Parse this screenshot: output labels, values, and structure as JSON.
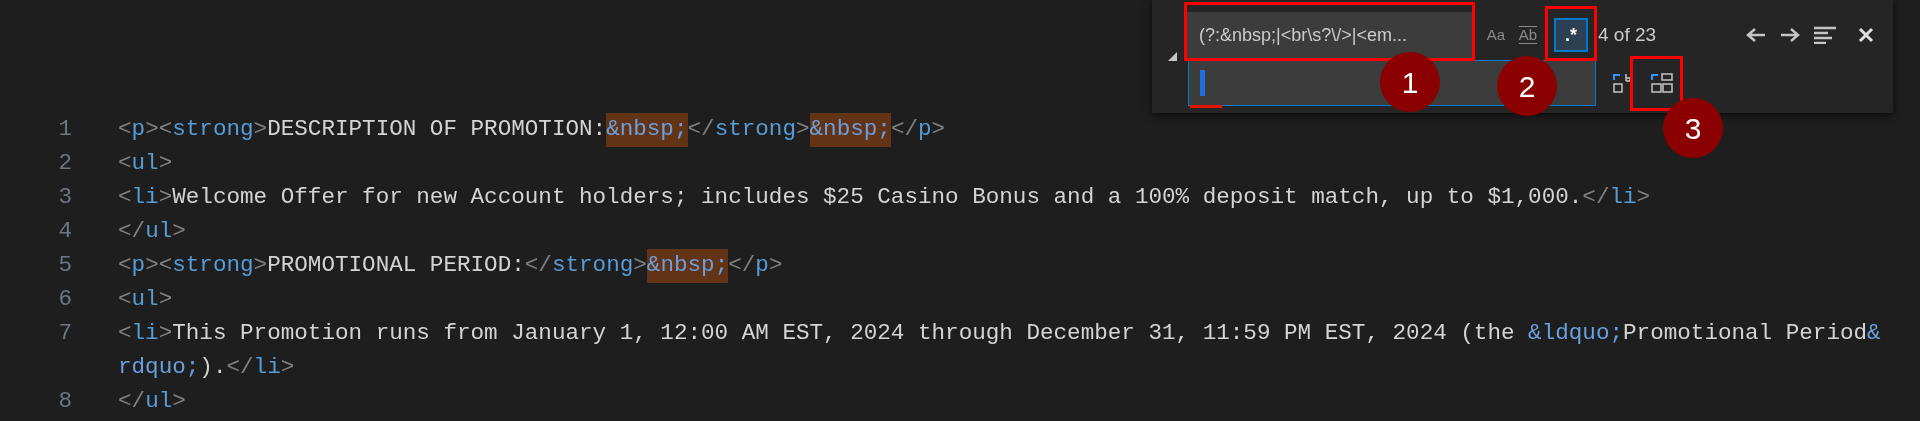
{
  "editor": {
    "lines": [
      {
        "number": "1",
        "tokens": [
          {
            "kind": "bracket",
            "text": "<"
          },
          {
            "kind": "tag",
            "text": "p"
          },
          {
            "kind": "bracket",
            "text": "><"
          },
          {
            "kind": "tag",
            "text": "strong"
          },
          {
            "kind": "bracket",
            "text": ">"
          },
          {
            "kind": "text",
            "text": "DESCRIPTION OF PROMOTION:"
          },
          {
            "kind": "entity",
            "text": "&nbsp;",
            "match": true
          },
          {
            "kind": "bracket",
            "text": "</"
          },
          {
            "kind": "tag",
            "text": "strong"
          },
          {
            "kind": "bracket",
            "text": ">"
          },
          {
            "kind": "entity",
            "text": "&nbsp;",
            "match": true
          },
          {
            "kind": "bracket",
            "text": "</"
          },
          {
            "kind": "tag",
            "text": "p"
          },
          {
            "kind": "bracket",
            "text": ">"
          }
        ]
      },
      {
        "number": "2",
        "tokens": [
          {
            "kind": "bracket",
            "text": "<"
          },
          {
            "kind": "tag",
            "text": "ul"
          },
          {
            "kind": "bracket",
            "text": ">"
          }
        ]
      },
      {
        "number": "3",
        "tokens": [
          {
            "kind": "bracket",
            "text": "<"
          },
          {
            "kind": "tag",
            "text": "li"
          },
          {
            "kind": "bracket",
            "text": ">"
          },
          {
            "kind": "text",
            "text": "Welcome Offer for new Account holders; includes $25 Casino Bonus and a 100% deposit match, up to $1,000."
          },
          {
            "kind": "bracket",
            "text": "</"
          },
          {
            "kind": "tag",
            "text": "li"
          },
          {
            "kind": "bracket",
            "text": ">"
          }
        ]
      },
      {
        "number": "4",
        "tokens": [
          {
            "kind": "bracket",
            "text": "</"
          },
          {
            "kind": "tag",
            "text": "ul"
          },
          {
            "kind": "bracket",
            "text": ">"
          }
        ]
      },
      {
        "number": "5",
        "tokens": [
          {
            "kind": "bracket",
            "text": "<"
          },
          {
            "kind": "tag",
            "text": "p"
          },
          {
            "kind": "bracket",
            "text": "><"
          },
          {
            "kind": "tag",
            "text": "strong"
          },
          {
            "kind": "bracket",
            "text": ">"
          },
          {
            "kind": "text",
            "text": "PROMOTIONAL PERIOD:"
          },
          {
            "kind": "bracket",
            "text": "</"
          },
          {
            "kind": "tag",
            "text": "strong"
          },
          {
            "kind": "bracket",
            "text": ">"
          },
          {
            "kind": "entity",
            "text": "&nbsp;",
            "match": true
          },
          {
            "kind": "bracket",
            "text": "</"
          },
          {
            "kind": "tag",
            "text": "p"
          },
          {
            "kind": "bracket",
            "text": ">"
          }
        ]
      },
      {
        "number": "6",
        "tokens": [
          {
            "kind": "bracket",
            "text": "<"
          },
          {
            "kind": "tag",
            "text": "ul"
          },
          {
            "kind": "bracket",
            "text": ">"
          }
        ]
      },
      {
        "number": "7",
        "tokens": [
          {
            "kind": "bracket",
            "text": "<"
          },
          {
            "kind": "tag",
            "text": "li"
          },
          {
            "kind": "bracket",
            "text": ">"
          },
          {
            "kind": "text",
            "text": "This Promotion runs from January 1, 12:00 AM EST, 2024 through December 31, 11:59 PM EST, 2024 (the "
          },
          {
            "kind": "entity",
            "text": "&ldquo;",
            "match": false
          },
          {
            "kind": "text",
            "text": "Promotional Period"
          },
          {
            "kind": "entity",
            "text": "&",
            "match": false
          }
        ]
      },
      {
        "tokens": [
          {
            "kind": "entity",
            "text": "rdquo;",
            "match": false
          },
          {
            "kind": "text",
            "text": ")."
          },
          {
            "kind": "bracket",
            "text": "</"
          },
          {
            "kind": "tag",
            "text": "li"
          },
          {
            "kind": "bracket",
            "text": ">"
          }
        ]
      },
      {
        "number": "8",
        "tokens": [
          {
            "kind": "bracket",
            "text": "</"
          },
          {
            "kind": "tag",
            "text": "ul"
          },
          {
            "kind": "bracket",
            "text": ">"
          }
        ]
      }
    ]
  },
  "find_widget": {
    "search": {
      "value": "(?:&nbsp;|<br\\s?\\/>|<em..."
    },
    "options": [
      {
        "kind": "case",
        "label": "Aa",
        "selected": false
      },
      {
        "kind": "word",
        "label": "Ab",
        "selected": false
      },
      {
        "kind": "regex",
        "label": ".*",
        "selected": true
      }
    ],
    "result_count": "4 of 23"
  },
  "callouts": [
    {
      "label": "1"
    },
    {
      "label": "2"
    },
    {
      "label": "3"
    }
  ]
}
